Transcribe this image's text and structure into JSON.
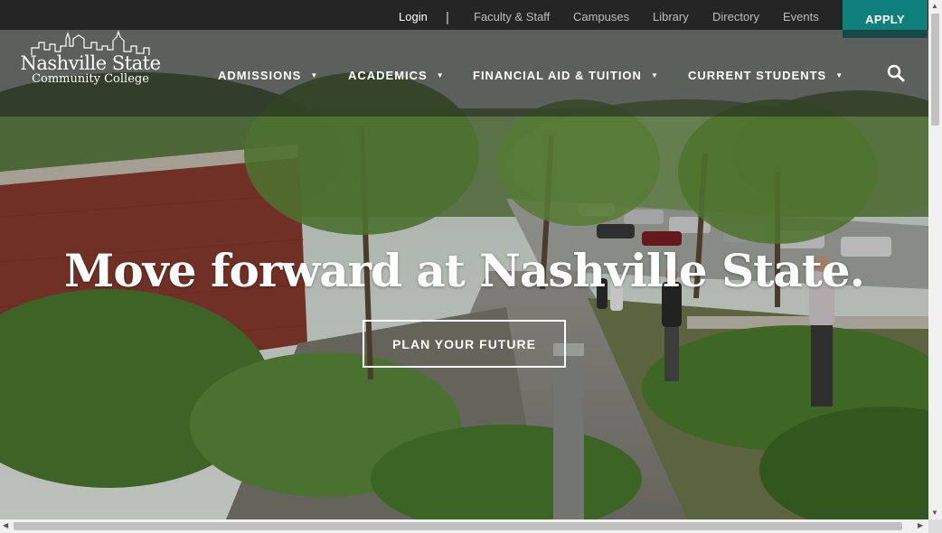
{
  "topbar": {
    "login": "Login",
    "separator": "|",
    "links": [
      "Faculty & Staff",
      "Campuses",
      "Library",
      "Directory",
      "Events"
    ],
    "apply": "APPLY"
  },
  "logo": {
    "line1": "Nashville State",
    "line2": "Community College"
  },
  "nav": {
    "items": [
      "ADMISSIONS",
      "ACADEMICS",
      "FINANCIAL AID & TUITION",
      "CURRENT STUDENTS"
    ],
    "caret": "▼"
  },
  "hero": {
    "headline": "Move forward at Nashville State.",
    "cta": "PLAN YOUR FUTURE"
  },
  "colors": {
    "apply_bg": "#0e7f7a",
    "topbar_bg": "#252525"
  }
}
